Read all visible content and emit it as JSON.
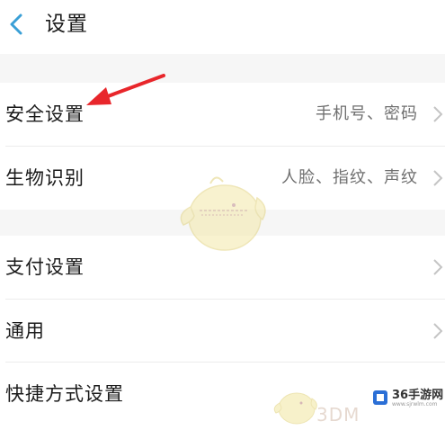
{
  "header": {
    "title": "设置",
    "back_icon": "chevron-left-icon"
  },
  "colors": {
    "accent": "#3a9fd6",
    "annotation_arrow": "#e8262b",
    "background": "#f6f6f6"
  },
  "groups": [
    {
      "items": [
        {
          "label": "安全设置",
          "value": "手机号、密码"
        },
        {
          "label": "生物识别",
          "value": "人脸、指纹、声纹"
        }
      ]
    },
    {
      "items": [
        {
          "label": "支付设置",
          "value": ""
        },
        {
          "label": "通用",
          "value": ""
        },
        {
          "label": "快捷方式设置",
          "value": ""
        }
      ]
    }
  ],
  "watermarks": {
    "site_3dm": "3DM",
    "site_36_name": "36手游网",
    "site_36_url": "www.sjrwlm.com"
  }
}
